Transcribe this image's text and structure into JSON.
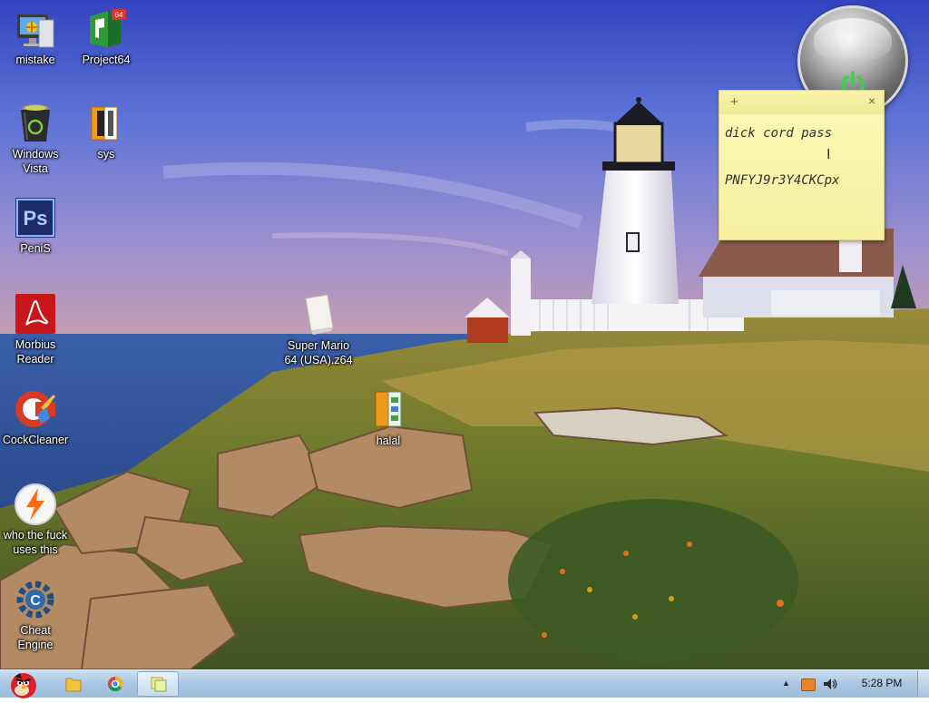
{
  "desktop": {
    "icons": [
      {
        "label": "mistake"
      },
      {
        "label": "Project64"
      },
      {
        "label": "Windows\nVista"
      },
      {
        "label": "sys"
      },
      {
        "label": "PeniS"
      },
      {
        "label": "Morbius\nReader"
      },
      {
        "label": "Super Mario\n64 (USA).z64"
      },
      {
        "label": "halal"
      },
      {
        "label": "CockCleaner"
      },
      {
        "label": "who the fuck\nuses this"
      },
      {
        "label": "Cheat\nEngine"
      }
    ]
  },
  "sticky_note": {
    "line1": "dick cord pass",
    "line2": "PNFYJ9r3Y4CKCpx",
    "plus": "+",
    "close": "×"
  },
  "taskbar": {
    "clock": "5:28 PM",
    "tray_arrow": "▲"
  },
  "colors": {
    "sky_top": "#3b4fc4",
    "sticky": "#f8f3ae",
    "taskbar": "#b3cde6"
  }
}
